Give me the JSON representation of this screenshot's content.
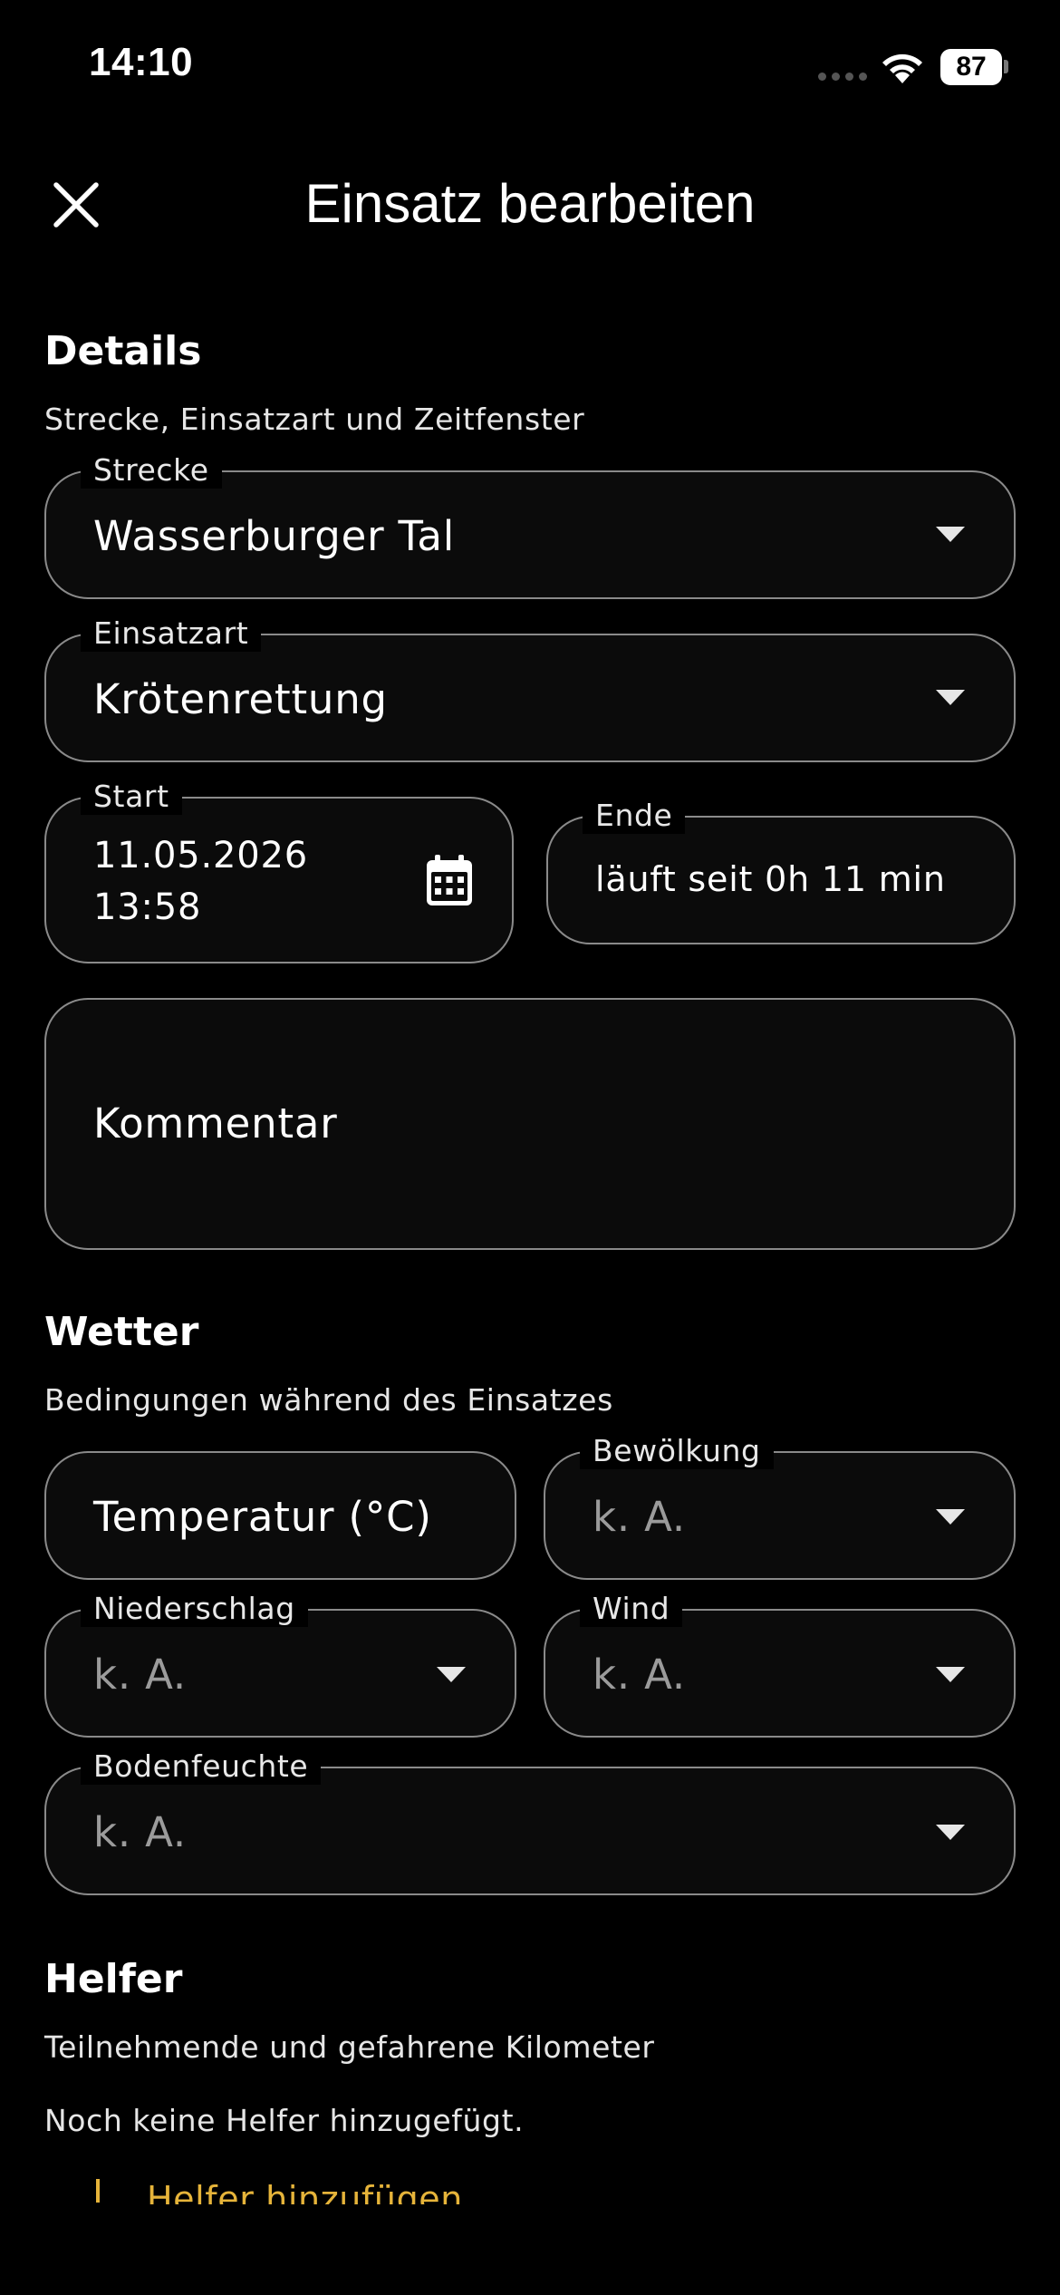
{
  "status_bar": {
    "time": "14:10",
    "battery": "87"
  },
  "header": {
    "title": "Einsatz bearbeiten"
  },
  "details": {
    "title": "Details",
    "subtitle": "Strecke, Einsatzart und Zeitfenster",
    "strecke": {
      "label": "Strecke",
      "value": "Wasserburger Tal"
    },
    "einsatzart": {
      "label": "Einsatzart",
      "value": "Krötenrettung"
    },
    "start": {
      "label": "Start",
      "date": "11.05.2026",
      "time": "13:58"
    },
    "ende": {
      "label": "Ende",
      "value": "läuft seit 0h 11 min"
    },
    "kommentar": {
      "placeholder": "Kommentar"
    }
  },
  "wetter": {
    "title": "Wetter",
    "subtitle": "Bedingungen während des Einsatzes",
    "temperatur": {
      "placeholder": "Temperatur (°C)"
    },
    "bewoelkung": {
      "label": "Bewölkung",
      "value": "k. A."
    },
    "niederschlag": {
      "label": "Niederschlag",
      "value": "k. A."
    },
    "wind": {
      "label": "Wind",
      "value": "k. A."
    },
    "bodenfeuchte": {
      "label": "Bodenfeuchte",
      "value": "k. A."
    }
  },
  "helfer": {
    "title": "Helfer",
    "subtitle": "Teilnehmende und gefahrene Kilometer",
    "empty_text": "Noch keine Helfer hinzugefügt.",
    "add_label": "Helfer hinzufügen"
  },
  "colors": {
    "accent": "#e6b43a",
    "background": "#000000",
    "field_border": "#8a8a8a"
  }
}
